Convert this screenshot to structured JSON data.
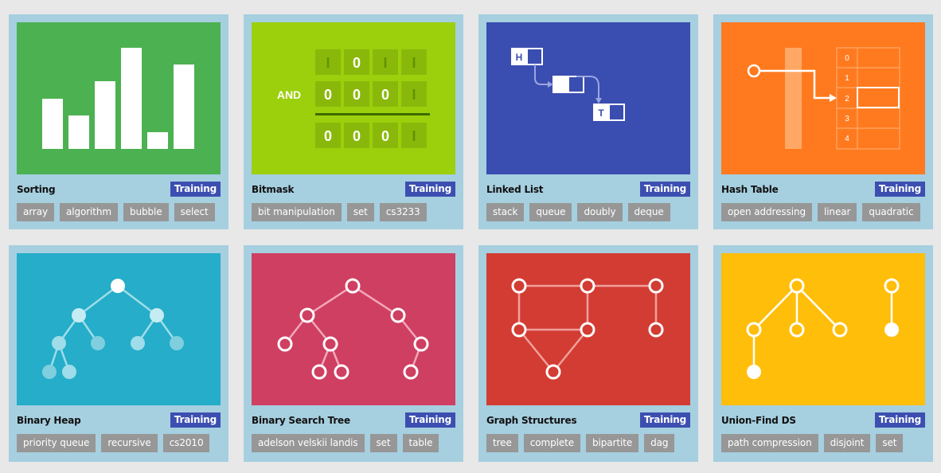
{
  "cards": [
    {
      "title": "Sorting",
      "badge": "Training",
      "tags": [
        "array",
        "algorithm",
        "bubble",
        "select"
      ]
    },
    {
      "title": "Bitmask",
      "badge": "Training",
      "tags": [
        "bit manipulation",
        "set",
        "cs3233"
      ]
    },
    {
      "title": "Linked List",
      "badge": "Training",
      "tags": [
        "stack",
        "queue",
        "doubly",
        "deque"
      ]
    },
    {
      "title": "Hash Table",
      "badge": "Training",
      "tags": [
        "open addressing",
        "linear",
        "quadratic"
      ]
    },
    {
      "title": "Binary Heap",
      "badge": "Training",
      "tags": [
        "priority queue",
        "recursive",
        "cs2010"
      ]
    },
    {
      "title": "Binary Search Tree",
      "badge": "Training",
      "tags": [
        "adelson velskii landis",
        "set",
        "table"
      ]
    },
    {
      "title": "Graph Structures",
      "badge": "Training",
      "tags": [
        "tree",
        "complete",
        "bipartite",
        "dag"
      ]
    },
    {
      "title": "Union-Find DS",
      "badge": "Training",
      "tags": [
        "path compression",
        "disjoint",
        "set"
      ]
    }
  ],
  "illustrations": {
    "bitmask": {
      "operator": "AND",
      "row1": [
        "I",
        "0",
        "I",
        "I"
      ],
      "row2": [
        "0",
        "0",
        "0",
        "I"
      ],
      "result": [
        "0",
        "0",
        "0",
        "I"
      ]
    },
    "linked_list": {
      "head_label": "H",
      "tail_label": "T"
    },
    "hash_table": {
      "indices": [
        "0",
        "1",
        "2",
        "3",
        "4"
      ]
    }
  },
  "colors": {
    "page_background": "#e8e8e8",
    "card_background": "#a6cfe0",
    "badge": "#3c4fb0",
    "tag": "#979797",
    "sorting": "#4cb151",
    "bitmask": "#9ccf0c",
    "linked_list": "#3a4db0",
    "hash_table": "#ff7a1f",
    "binary_heap": "#25adc9",
    "bst": "#cf3f62",
    "graph": "#d23c33",
    "union_find": "#ffbe0a"
  }
}
